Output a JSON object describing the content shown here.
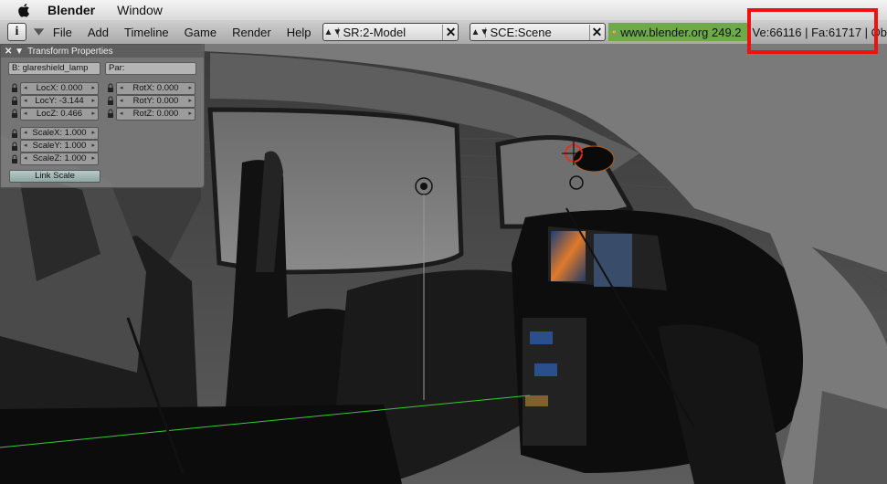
{
  "macmenu": {
    "app": "Blender",
    "items": [
      "Window"
    ]
  },
  "header": {
    "menus": [
      "File",
      "Add",
      "Timeline",
      "Game",
      "Render",
      "Help"
    ],
    "screen_browser": "SR:2-Model",
    "scene_browser": "SCE:Scene",
    "url": "www.blender.org 249.2",
    "stats": "Ve:66116 | Fa:61717 | Ob",
    "info_color": "#6ea94a"
  },
  "panel": {
    "title": "Transform Properties",
    "object_name": "B: glareshield_lamp",
    "parent": "Par:",
    "loc": [
      "LocX: 0.000",
      "LocY: -3.144",
      "LocZ: 0.466"
    ],
    "rot": [
      "RotX: 0.000",
      "RotY: 0.000",
      "RotZ: 0.000"
    ],
    "scale": [
      "ScaleX: 1.000",
      "ScaleY: 1.000",
      "ScaleZ: 1.000"
    ],
    "link_scale": "Link Scale"
  },
  "highlight_color": "#ee1111"
}
